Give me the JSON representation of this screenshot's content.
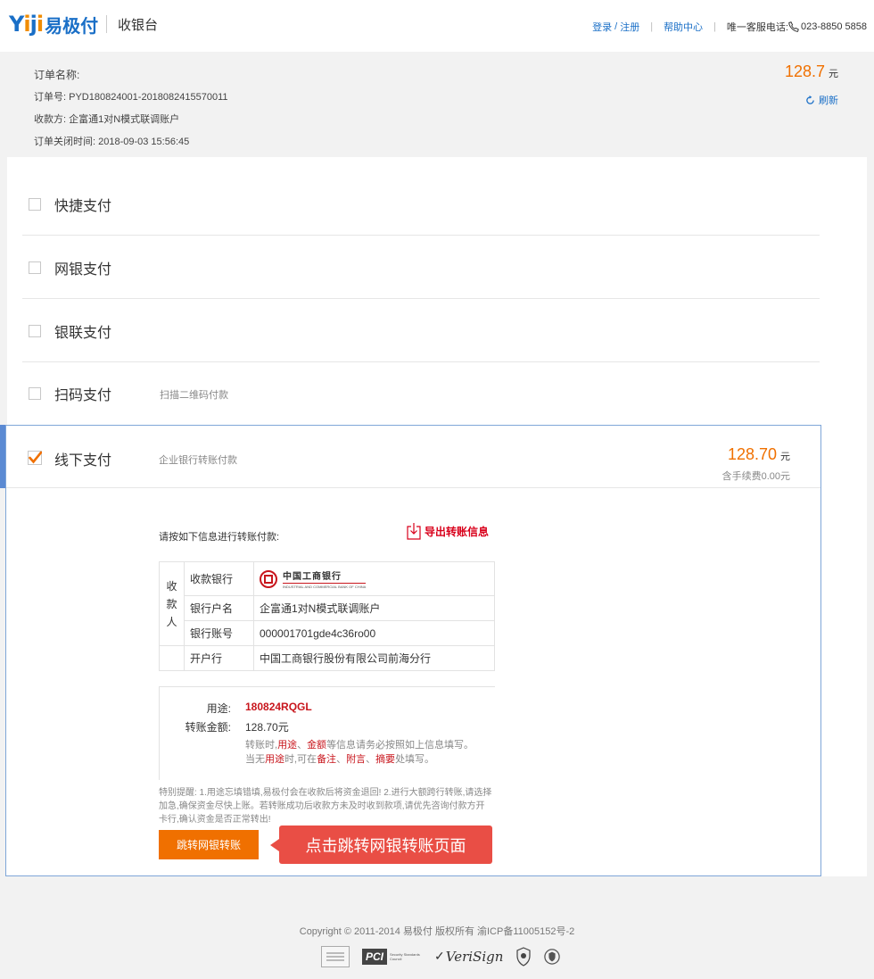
{
  "header": {
    "logo_text": "Yiji",
    "logo_cn": "易极付",
    "title": "收银台",
    "login": "登录",
    "slash": "/",
    "register": "注册",
    "help": "帮助中心",
    "hotline_label": "唯一客服电话:",
    "hotline": "023-8850 5858"
  },
  "order": {
    "name_label": "订单名称:",
    "number": "订单号: PYD180824001-2018082415570011",
    "payee": "收款方: 企富通1对N模式联调账户",
    "close_time": "订单关闭时间: 2018-09-03 15:56:45",
    "amount": "128.7",
    "unit": "元",
    "refresh": "刷新"
  },
  "methods": [
    {
      "label": "快捷支付",
      "desc": ""
    },
    {
      "label": "网银支付",
      "desc": ""
    },
    {
      "label": "银联支付",
      "desc": ""
    },
    {
      "label": "扫码支付",
      "desc": "扫描二维码付款"
    }
  ],
  "offline": {
    "label": "线下支付",
    "desc": "企业银行转账付款",
    "amount": "128.70",
    "unit": "元",
    "fee": "含手续费0.00元",
    "instruction": "请按如下信息进行转账付款:",
    "export": "导出转账信息",
    "payee_header": "收款人",
    "rows": {
      "bank_key": "收款银行",
      "bank_name_cn": "中国工商银行",
      "bank_name_en": "INDUSTRIAL AND COMMERCIAL BANK OF CHINA",
      "acct_name_key": "银行户名",
      "acct_name": "企富通1对N模式联调账户",
      "acct_no_key": "银行账号",
      "acct_no": "000001701gde4c36ro00",
      "branch_key": "开户行",
      "branch": "中国工商银行股份有限公司前海分行"
    },
    "purpose_key": "用途:",
    "purpose_val": "180824RQGL",
    "amount_key": "转账金额:",
    "amount_val": "128.70元",
    "note1_a": "转账时,",
    "note1_b": "用途",
    "note1_c": "、",
    "note1_d": "金额",
    "note1_e": "等信息请务必按照如上信息填写。",
    "note2_a": "当无",
    "note2_b": "用途",
    "note2_c": "时,可在",
    "note2_d": "备注",
    "note2_e": "、",
    "note2_f": "附言",
    "note2_g": "、",
    "note2_h": "摘要",
    "note2_i": "处填写。",
    "tips": "特别提醒: 1.用途忘填错填,易极付会在收款后将资金退回! 2.进行大额跨行转账,请选择加急,确保资金尽快上账。若转账成功后收款方未及时收到款项,请优先咨询付款方开卡行,确认资金是否正常转出!",
    "button": "跳转网银转账",
    "callout": "点击跳转网银转账页面"
  },
  "footer": {
    "copyright": "Copyright © 2011-2014 易极付 版权所有 渝ICP备11005152号-2",
    "pci": "PCI",
    "pci_sub": "Security Standards Council",
    "verisign": "VeriSign"
  },
  "colors": {
    "brand_blue": "#1a6fc7",
    "amount_orange": "#f07000",
    "alert_red": "#c8161d",
    "callout_red": "#e94e45"
  }
}
